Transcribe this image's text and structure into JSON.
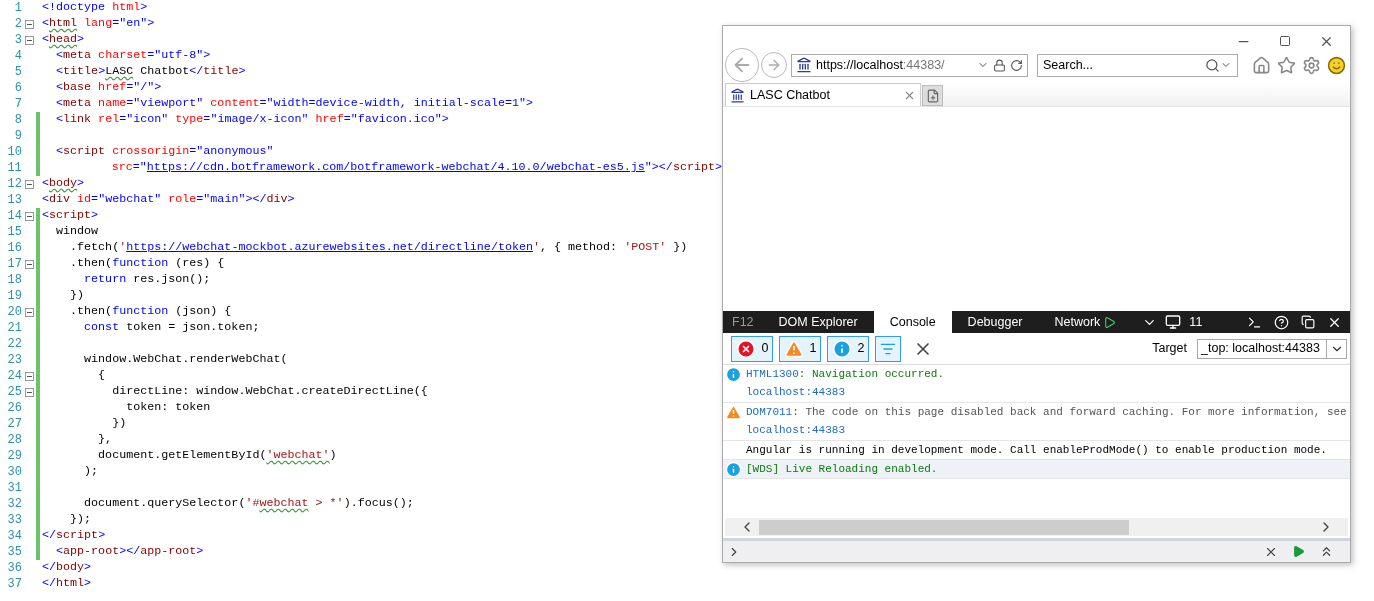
{
  "editor": {
    "lines": [
      {
        "number": "1",
        "changed": false,
        "foldable": false,
        "tokens": [
          {
            "kind": "delim",
            "text": "<!doctype"
          },
          {
            "kind": "attr",
            "text": " html"
          },
          {
            "kind": "delim",
            "text": ">"
          }
        ]
      },
      {
        "number": "2",
        "changed": false,
        "foldable": true,
        "tokens": [
          {
            "kind": "delim",
            "text": "<"
          },
          {
            "kind": "element",
            "text": "html",
            "squiggle": true
          },
          {
            "kind": "attr",
            "text": " lang"
          },
          {
            "kind": "delim",
            "text": "="
          },
          {
            "kind": "value",
            "text": "\"en\""
          },
          {
            "kind": "delim",
            "text": ">"
          }
        ]
      },
      {
        "number": "3",
        "changed": false,
        "foldable": true,
        "tokens": [
          {
            "kind": "delim",
            "text": "<"
          },
          {
            "kind": "element",
            "text": "head",
            "squiggle": true
          },
          {
            "kind": "delim",
            "text": ">"
          }
        ]
      },
      {
        "number": "4",
        "changed": false,
        "foldable": false,
        "tokens": [
          {
            "kind": "delim",
            "text": "  <"
          },
          {
            "kind": "element",
            "text": "meta"
          },
          {
            "kind": "attr",
            "text": " charset"
          },
          {
            "kind": "delim",
            "text": "="
          },
          {
            "kind": "value",
            "text": "\"utf-8\""
          },
          {
            "kind": "delim",
            "text": ">"
          }
        ]
      },
      {
        "number": "5",
        "changed": false,
        "foldable": false,
        "tokens": [
          {
            "kind": "delim",
            "text": "  <"
          },
          {
            "kind": "element",
            "text": "title"
          },
          {
            "kind": "delim",
            "text": ">"
          },
          {
            "kind": "plain",
            "text": "LASC",
            "squiggle": true
          },
          {
            "kind": "plain",
            "text": " Chatbot"
          },
          {
            "kind": "delim",
            "text": "</"
          },
          {
            "kind": "element",
            "text": "title"
          },
          {
            "kind": "delim",
            "text": ">"
          }
        ]
      },
      {
        "number": "6",
        "changed": false,
        "foldable": false,
        "tokens": [
          {
            "kind": "delim",
            "text": "  <"
          },
          {
            "kind": "element",
            "text": "base"
          },
          {
            "kind": "attr",
            "text": " href"
          },
          {
            "kind": "delim",
            "text": "="
          },
          {
            "kind": "value",
            "text": "\"/\""
          },
          {
            "kind": "delim",
            "text": ">"
          }
        ]
      },
      {
        "number": "7",
        "changed": false,
        "foldable": false,
        "tokens": [
          {
            "kind": "delim",
            "text": "  <"
          },
          {
            "kind": "element",
            "text": "meta"
          },
          {
            "kind": "attr",
            "text": " name"
          },
          {
            "kind": "delim",
            "text": "="
          },
          {
            "kind": "value",
            "text": "\"viewport\""
          },
          {
            "kind": "attr",
            "text": " content"
          },
          {
            "kind": "delim",
            "text": "="
          },
          {
            "kind": "value",
            "text": "\"width=device-width, initial-scale=1\""
          },
          {
            "kind": "delim",
            "text": ">"
          }
        ]
      },
      {
        "number": "8",
        "changed": true,
        "foldable": false,
        "tokens": [
          {
            "kind": "delim",
            "text": "  <"
          },
          {
            "kind": "element",
            "text": "link"
          },
          {
            "kind": "attr",
            "text": " rel"
          },
          {
            "kind": "delim",
            "text": "="
          },
          {
            "kind": "value",
            "text": "\"icon\""
          },
          {
            "kind": "attr",
            "text": " type"
          },
          {
            "kind": "delim",
            "text": "="
          },
          {
            "kind": "value",
            "text": "\"image/x-icon\""
          },
          {
            "kind": "attr",
            "text": " href"
          },
          {
            "kind": "delim",
            "text": "="
          },
          {
            "kind": "value",
            "text": "\"favicon.ico\""
          },
          {
            "kind": "delim",
            "text": ">"
          }
        ]
      },
      {
        "number": "9",
        "changed": true,
        "foldable": false
      },
      {
        "number": "10",
        "changed": true,
        "foldable": false,
        "tokens": [
          {
            "kind": "delim",
            "text": "  <"
          },
          {
            "kind": "element",
            "text": "script"
          },
          {
            "kind": "attr",
            "text": " crossorigin"
          },
          {
            "kind": "delim",
            "text": "="
          },
          {
            "kind": "value",
            "text": "\"anonymous\""
          }
        ]
      },
      {
        "number": "11",
        "changed": true,
        "foldable": false,
        "tokens": [
          {
            "kind": "attr",
            "text": "          src"
          },
          {
            "kind": "delim",
            "text": "="
          },
          {
            "kind": "value",
            "text": "\""
          },
          {
            "kind": "link",
            "text": "https://cdn.botframework.com/botframework-webchat/4.10.0/webchat-es5.js"
          },
          {
            "kind": "value",
            "text": "\""
          },
          {
            "kind": "delim",
            "text": "></"
          },
          {
            "kind": "element",
            "text": "script"
          },
          {
            "kind": "delim",
            "text": ">"
          }
        ]
      },
      {
        "number": "12",
        "changed": false,
        "foldable": true,
        "tokens": [
          {
            "kind": "delim",
            "text": "<"
          },
          {
            "kind": "element",
            "text": "body",
            "squiggle": true
          },
          {
            "kind": "delim",
            "text": ">"
          }
        ]
      },
      {
        "number": "13",
        "changed": false,
        "foldable": false,
        "tokens": [
          {
            "kind": "delim",
            "text": "<"
          },
          {
            "kind": "element",
            "text": "div"
          },
          {
            "kind": "attr",
            "text": " id"
          },
          {
            "kind": "delim",
            "text": "="
          },
          {
            "kind": "value",
            "text": "\"webchat\""
          },
          {
            "kind": "attr",
            "text": " role"
          },
          {
            "kind": "delim",
            "text": "="
          },
          {
            "kind": "value",
            "text": "\"main\""
          },
          {
            "kind": "delim",
            "text": "></"
          },
          {
            "kind": "element",
            "text": "div"
          },
          {
            "kind": "delim",
            "text": ">"
          }
        ]
      },
      {
        "number": "14",
        "changed": true,
        "foldable": true,
        "tokens": [
          {
            "kind": "delim",
            "text": "<"
          },
          {
            "kind": "element",
            "text": "script"
          },
          {
            "kind": "delim",
            "text": ">"
          }
        ]
      },
      {
        "number": "15",
        "changed": true,
        "foldable": false,
        "tokens": [
          {
            "kind": "plain",
            "text": "  window"
          }
        ]
      },
      {
        "number": "16",
        "changed": true,
        "foldable": false,
        "tokens": [
          {
            "kind": "plain",
            "text": "    .fetch("
          },
          {
            "kind": "string",
            "text": "'"
          },
          {
            "kind": "link",
            "text": "https://webchat-mockbot.azurewebsites.net/directline/token"
          },
          {
            "kind": "string",
            "text": "'"
          },
          {
            "kind": "plain",
            "text": ", { method: "
          },
          {
            "kind": "string",
            "text": "'POST'"
          },
          {
            "kind": "plain",
            "text": " })"
          }
        ]
      },
      {
        "number": "17",
        "changed": true,
        "foldable": true,
        "tokens": [
          {
            "kind": "plain",
            "text": "    .then("
          },
          {
            "kind": "keyword",
            "text": "function"
          },
          {
            "kind": "plain",
            "text": " (res) {"
          }
        ]
      },
      {
        "number": "18",
        "changed": true,
        "foldable": false,
        "tokens": [
          {
            "kind": "keyword",
            "text": "      return"
          },
          {
            "kind": "plain",
            "text": " res.json();"
          }
        ]
      },
      {
        "number": "19",
        "changed": true,
        "foldable": false,
        "tokens": [
          {
            "kind": "plain",
            "text": "    })"
          }
        ]
      },
      {
        "number": "20",
        "changed": true,
        "foldable": true,
        "tokens": [
          {
            "kind": "plain",
            "text": "    .then("
          },
          {
            "kind": "keyword",
            "text": "function"
          },
          {
            "kind": "plain",
            "text": " (json) {"
          }
        ]
      },
      {
        "number": "21",
        "changed": true,
        "foldable": false,
        "tokens": [
          {
            "kind": "keyword",
            "text": "      const"
          },
          {
            "kind": "plain",
            "text": " token = json.token;"
          }
        ]
      },
      {
        "number": "22",
        "changed": true,
        "foldable": false
      },
      {
        "number": "23",
        "changed": true,
        "foldable": false,
        "tokens": [
          {
            "kind": "plain",
            "text": "      window.WebChat.renderWebChat("
          }
        ]
      },
      {
        "number": "24",
        "changed": true,
        "foldable": true,
        "tokens": [
          {
            "kind": "plain",
            "text": "        {"
          }
        ]
      },
      {
        "number": "25",
        "changed": true,
        "foldable": true,
        "tokens": [
          {
            "kind": "plain",
            "text": "          directLine: window.WebChat.createDirectLine({"
          }
        ]
      },
      {
        "number": "26",
        "changed": true,
        "foldable": false,
        "tokens": [
          {
            "kind": "plain",
            "text": "            token: token"
          }
        ]
      },
      {
        "number": "27",
        "changed": true,
        "foldable": false,
        "tokens": [
          {
            "kind": "plain",
            "text": "          })"
          }
        ]
      },
      {
        "number": "28",
        "changed": true,
        "foldable": false,
        "tokens": [
          {
            "kind": "plain",
            "text": "        },"
          }
        ]
      },
      {
        "number": "29",
        "changed": true,
        "foldable": false,
        "tokens": [
          {
            "kind": "plain",
            "text": "        document.getElementById("
          },
          {
            "kind": "string",
            "text": "'webchat'",
            "squiggle": true
          },
          {
            "kind": "plain",
            "text": ")"
          }
        ]
      },
      {
        "number": "30",
        "changed": true,
        "foldable": false,
        "tokens": [
          {
            "kind": "plain",
            "text": "      );"
          }
        ]
      },
      {
        "number": "31",
        "changed": true,
        "foldable": false
      },
      {
        "number": "32",
        "changed": true,
        "foldable": false,
        "tokens": [
          {
            "kind": "plain",
            "text": "      document.querySelector("
          },
          {
            "kind": "string",
            "text": "'#"
          },
          {
            "kind": "string",
            "text": "webchat",
            "squiggle": true
          },
          {
            "kind": "string",
            "text": " > *'"
          },
          {
            "kind": "plain",
            "text": ").focus();"
          }
        ]
      },
      {
        "number": "33",
        "changed": true,
        "foldable": false,
        "tokens": [
          {
            "kind": "plain",
            "text": "    });"
          }
        ]
      },
      {
        "number": "34",
        "changed": true,
        "foldable": false,
        "tokens": [
          {
            "kind": "delim",
            "text": "</"
          },
          {
            "kind": "element",
            "text": "script"
          },
          {
            "kind": "delim",
            "text": ">"
          }
        ]
      },
      {
        "number": "35",
        "changed": true,
        "foldable": false,
        "tokens": [
          {
            "kind": "delim",
            "text": "  <"
          },
          {
            "kind": "element",
            "text": "app-root"
          },
          {
            "kind": "delim",
            "text": "></"
          },
          {
            "kind": "element",
            "text": "app-root"
          },
          {
            "kind": "delim",
            "text": ">"
          }
        ]
      },
      {
        "number": "36",
        "changed": false,
        "foldable": false,
        "tokens": [
          {
            "kind": "delim",
            "text": "</"
          },
          {
            "kind": "element",
            "text": "body"
          },
          {
            "kind": "delim",
            "text": ">"
          }
        ]
      },
      {
        "number": "37",
        "changed": false,
        "foldable": false,
        "tokens": [
          {
            "kind": "delim",
            "text": "</"
          },
          {
            "kind": "element",
            "text": "html"
          },
          {
            "kind": "delim",
            "text": ">"
          }
        ]
      }
    ]
  },
  "browser": {
    "address": {
      "host": "https://localhost",
      "rest": ":44383/"
    },
    "search": {
      "placeholder": "Search..."
    },
    "tabs": [
      {
        "label": "LASC Chatbot",
        "selected": true
      }
    ],
    "devtools": {
      "f12_label": "F12",
      "tabs": [
        {
          "label": "DOM Explorer",
          "selected": false
        },
        {
          "label": "Console",
          "selected": true
        },
        {
          "label": "Debugger",
          "selected": false
        },
        {
          "label": "Network",
          "selected": false
        }
      ],
      "emulation_version": "11",
      "filters": [
        {
          "kind": "error",
          "count": "0",
          "selected": true
        },
        {
          "kind": "warning",
          "count": "1",
          "selected": true
        },
        {
          "kind": "info",
          "count": "2",
          "selected": true
        }
      ],
      "target": {
        "label": "Target",
        "value": "_top: localhost:44383"
      },
      "messages": [
        {
          "kind": "info",
          "code": "HTML1300",
          "text": ": Navigation occurred.",
          "source": "localhost:44383",
          "selected": false
        },
        {
          "kind": "warning",
          "code": "DOM7011",
          "text": ": The code on this page disabled back and forward caching. For more information, see",
          "source": "localhost:44383",
          "selected": false
        },
        {
          "kind": "log",
          "text": "Angular is running in development mode. Call enableProdMode() to enable production mode.",
          "selected": false
        },
        {
          "kind": "info",
          "text": "[WDS] Live Reloading enabled.",
          "selected": true
        }
      ]
    }
  }
}
